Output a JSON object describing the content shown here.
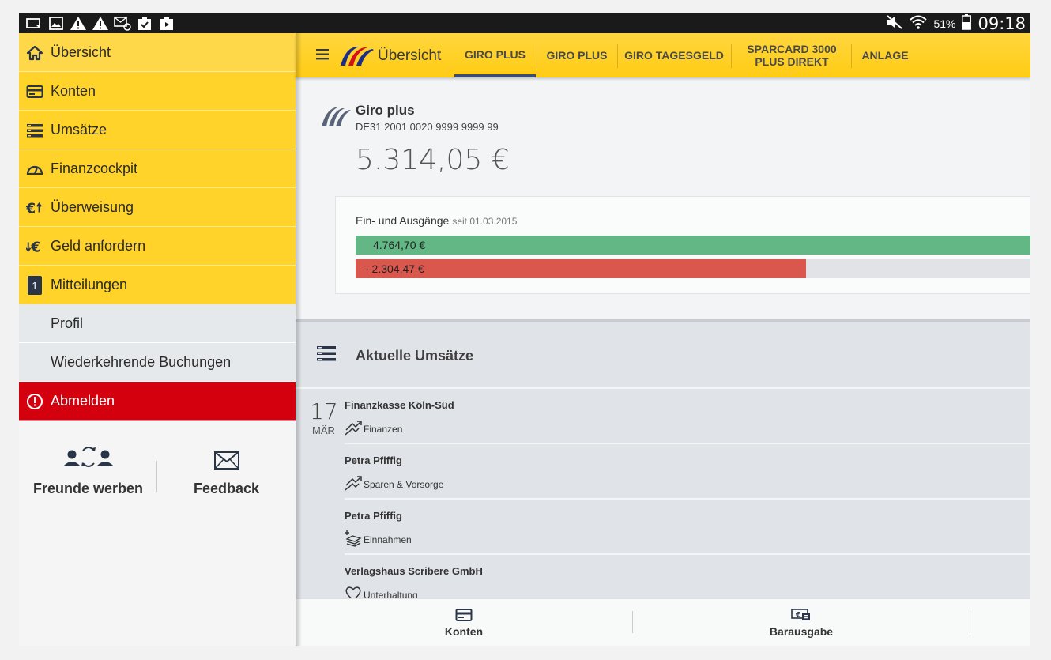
{
  "status_bar": {
    "battery": "51%",
    "time": "09:18"
  },
  "sidebar": {
    "items": [
      {
        "label": "Übersicht",
        "icon": "home-icon"
      },
      {
        "label": "Konten",
        "icon": "card-icon"
      },
      {
        "label": "Umsätze",
        "icon": "list-icon"
      },
      {
        "label": "Finanzcockpit",
        "icon": "gauge-icon"
      },
      {
        "label": "Überweisung",
        "icon": "euro-transfer-icon"
      },
      {
        "label": "Geld anfordern",
        "icon": "euro-request-icon"
      },
      {
        "label": "Mitteilungen",
        "icon": "badge-icon",
        "badge": "1"
      }
    ],
    "sub_items": [
      {
        "label": "Profil"
      },
      {
        "label": "Wiederkehrende Buchungen"
      }
    ],
    "logout": {
      "label": "Abmelden",
      "icon": "power-icon"
    },
    "promo": [
      {
        "label": "Freunde werben",
        "icon": "refer-friends-icon"
      },
      {
        "label": "Feedback",
        "icon": "envelope-icon"
      }
    ]
  },
  "appbar": {
    "title": "Übersicht",
    "tabs": [
      {
        "label": "GIRO PLUS",
        "active": true
      },
      {
        "label": "GIRO PLUS",
        "active": false
      },
      {
        "label": "GIRO TAGESGELD",
        "active": false
      },
      {
        "label": "SPARCARD 3000 PLUS DIREKT",
        "active": false
      },
      {
        "label": "ANLAGE",
        "active": false
      }
    ]
  },
  "account": {
    "name": "Giro plus",
    "iban": "DE31 2001 0020 9999 9999 99",
    "balance": "5.314,05 €"
  },
  "flows": {
    "title": "Ein- und Ausgänge",
    "since": "seit 01.03.2015",
    "income": {
      "label": "4.764,70 €",
      "fraction": 1.0,
      "color": "#62b784"
    },
    "expense": {
      "label": "- 2.304,47 €",
      "fraction": 0.667,
      "color": "#d9574c"
    }
  },
  "transactions": {
    "title": "Aktuelle Umsätze",
    "date_day": "17",
    "date_month": "MÄR",
    "rows": [
      {
        "payee": "Finanzkasse Köln-Süd",
        "category": "Finanzen",
        "icon": "transfer-arrows-icon"
      },
      {
        "payee": "Petra Pfiffig",
        "category": "Sparen & Vorsorge",
        "icon": "transfer-arrows-icon"
      },
      {
        "payee": "Petra Pfiffig",
        "category": "Einnahmen",
        "icon": "income-stack-icon"
      },
      {
        "payee": "Verlagshaus Scribere GmbH",
        "category": "Unterhaltung",
        "icon": "heart-icon"
      }
    ]
  },
  "bottom_bar": {
    "items": [
      {
        "label": "Konten",
        "icon": "card-icon"
      },
      {
        "label": "Barausgabe",
        "icon": "cash-icon"
      }
    ]
  },
  "colors": {
    "brand_yellow": "#ffd32a",
    "brand_navy": "#3a4e74",
    "logout_red": "#d4000d"
  }
}
